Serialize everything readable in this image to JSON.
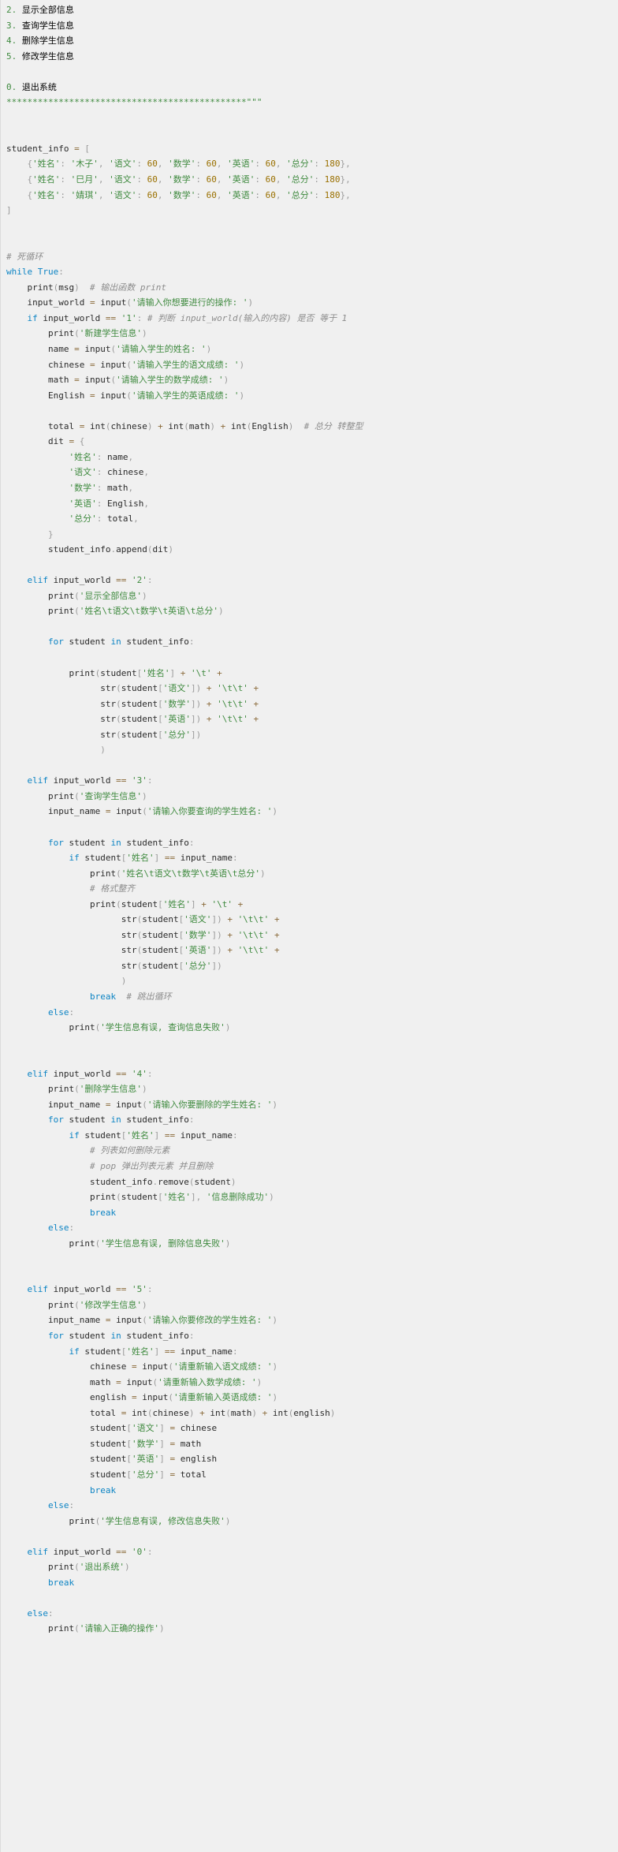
{
  "meta": {
    "language": "Python",
    "theme": "light",
    "background_color": "#f0f0f0",
    "colors": {
      "keyword": "#0d84c4",
      "string": "#3f8a3f",
      "number": "#9a7000",
      "comment": "#8c8c8c",
      "operator": "#8a6a3a",
      "identifier": "#2a2a2a",
      "punctuation": "#9a9a9a"
    }
  },
  "code": {
    "title": "student management system source code",
    "lines": [
      "2. 显示全部信息",
      "3. 查询学生信息",
      "4. 删除学生信息",
      "5. 修改学生信息",
      "",
      "0. 退出系统",
      "**********************************************\"\"\"",
      "",
      "",
      "student_info = [",
      "    {'姓名': '木子', '语文': 60, '数学': 60, '英语': 60, '总分': 180},",
      "    {'姓名': '巳月', '语文': 60, '数学': 60, '英语': 60, '总分': 180},",
      "    {'姓名': '婧琪', '语文': 60, '数学': 60, '英语': 60, '总分': 180},",
      "]",
      "",
      "",
      "# 死循环",
      "while True:",
      "    print(msg)  # 输出函数 print",
      "    input_world = input('请输入你想要进行的操作: ')",
      "    if input_world == '1': # 判断 input_world(输入的内容) 是否 等于 1",
      "        print('新建学生信息')",
      "        name = input('请输入学生的姓名: ')",
      "        chinese = input('请输入学生的语文成绩: ')",
      "        math = input('请输入学生的数学成绩: ')",
      "        English = input('请输入学生的英语成绩: ')",
      "",
      "        total = int(chinese) + int(math) + int(English)  # 总分 转整型",
      "        dit = {",
      "            '姓名': name,",
      "            '语文': chinese,",
      "            '数学': math,",
      "            '英语': English,",
      "            '总分': total,",
      "        }",
      "        student_info.append(dit)",
      "",
      "    elif input_world == '2':",
      "        print('显示全部信息')",
      "        print('姓名\\t语文\\t数学\\t英语\\t总分')",
      "",
      "        for student in student_info:",
      "",
      "            print(student['姓名'] + '\\t' +",
      "                  str(student['语文']) + '\\t\\t' +",
      "                  str(student['数学']) + '\\t\\t' +",
      "                  str(student['英语']) + '\\t\\t' +",
      "                  str(student['总分'])",
      "                  )",
      "",
      "    elif input_world == '3':",
      "        print('查询学生信息')",
      "        input_name = input('请输入你要查询的学生姓名: ')",
      "",
      "        for student in student_info:",
      "            if student['姓名'] == input_name:",
      "                print('姓名\\t语文\\t数学\\t英语\\t总分')",
      "                # 格式整齐",
      "                print(student['姓名'] + '\\t' +",
      "                      str(student['语文']) + '\\t\\t' +",
      "                      str(student['数学']) + '\\t\\t' +",
      "                      str(student['英语']) + '\\t\\t' +",
      "                      str(student['总分'])",
      "                      )",
      "                break  # 跳出循环",
      "        else:",
      "            print('学生信息有误, 查询信息失败')",
      "",
      "",
      "    elif input_world == '4':",
      "        print('删除学生信息')",
      "        input_name = input('请输入你要删除的学生姓名: ')",
      "        for student in student_info:",
      "            if student['姓名'] == input_name:",
      "                # 列表如何删除元素",
      "                # pop 弹出列表元素 并且删除",
      "                student_info.remove(student)",
      "                print(student['姓名'], '信息删除成功')",
      "                break",
      "        else:",
      "            print('学生信息有误, 删除信息失败')",
      "",
      "",
      "    elif input_world == '5':",
      "        print('修改学生信息')",
      "        input_name = input('请输入你要修改的学生姓名: ')",
      "        for student in student_info:",
      "            if student['姓名'] == input_name:",
      "                chinese = input('请重新输入语文成绩: ')",
      "                math = input('请重新输入数学成绩: ')",
      "                english = input('请重新输入英语成绩: ')",
      "                total = int(chinese) + int(math) + int(english)",
      "                student['语文'] = chinese",
      "                student['数学'] = math",
      "                student['英语'] = english",
      "                student['总分'] = total",
      "                break",
      "        else:",
      "            print('学生信息有误, 修改信息失败')",
      "",
      "    elif input_world == '0':",
      "        print('退出系统')",
      "        break",
      "",
      "    else:",
      "        print('请输入正确的操作')"
    ]
  }
}
